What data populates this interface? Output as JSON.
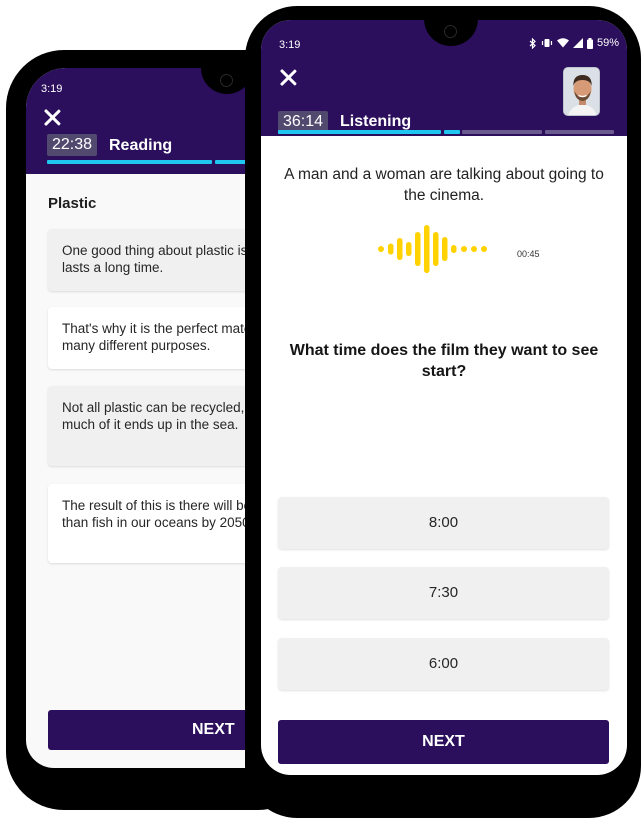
{
  "reading_screen": {
    "status_time": "3:19",
    "timer": "22:38",
    "section": "Reading",
    "passage_title": "Plastic",
    "paragraphs": [
      "One good thing about plastic is strong and lasts a long time.",
      "That's why it is the perfect material for so many different purposes.",
      "Not all plastic can be recycled, however, and much of it ends up in the sea.",
      "The result of this is there will be more plastic than fish in our oceans by 2050."
    ],
    "next_label": "NEXT",
    "colors": {
      "header": "#2b0f5c",
      "progress": "#1ec6f0"
    }
  },
  "listening_screen": {
    "status_time": "3:19",
    "battery": "59%",
    "timer": "36:14",
    "section": "Listening",
    "progress_segments": 4,
    "instruction": "A man and a woman are talking about going to the cinema.",
    "audio_duration": "00:45",
    "question": "What time does the film they want to see start?",
    "answers": [
      "8:00",
      "7:30",
      "6:00"
    ],
    "next_label": "NEXT",
    "icons": [
      "close-icon",
      "bluetooth-icon",
      "vibrate-icon",
      "wifi-icon",
      "signal-icon",
      "battery-icon",
      "audio-waveform-icon",
      "avatar"
    ],
    "colors": {
      "header": "#2b0f5c",
      "progress_active": "#1ec6f0",
      "progress_inactive": "#6a5a8e",
      "waveform": "#ffd200"
    }
  }
}
